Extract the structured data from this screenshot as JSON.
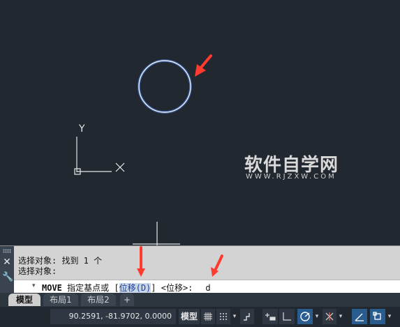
{
  "canvas": {
    "ucs": {
      "y_label": "Y",
      "x_label": "X"
    },
    "watermark": {
      "title": "软件自学网",
      "url": "WWW.RJZXW.COM"
    }
  },
  "command": {
    "history": [
      "选择对象: 找到 1 个",
      "选择对象:"
    ],
    "prompt_keyword": "MOVE",
    "prompt_text": " 指定基点或 [",
    "option_label": "位移(D)",
    "prompt_rest": "] <位移>:",
    "typed_value": "d",
    "close_icon": "close-icon",
    "settings_icon": "wrench-icon"
  },
  "layout_tabs": [
    {
      "label": "模型",
      "active": true
    },
    {
      "label": "布局1",
      "active": false
    },
    {
      "label": "布局2",
      "active": false
    },
    {
      "label": "+",
      "active": false
    }
  ],
  "status_bar": {
    "coordinates": "90.2591, -81.9702, 0.0000",
    "model_label": "模型",
    "buttons": [
      "grid-icon",
      "snap-icon",
      "infer-icon",
      "ortho-icon",
      "polar-icon",
      "isodraft-icon",
      "object-snap-tracking-icon",
      "object-snap-icon",
      "lineweight-icon"
    ]
  },
  "colors": {
    "canvas": "#212830",
    "circle": "#5f8ff0",
    "annotation_arrow": "#ff3b2f",
    "command_bg": "#d3d3d3"
  }
}
